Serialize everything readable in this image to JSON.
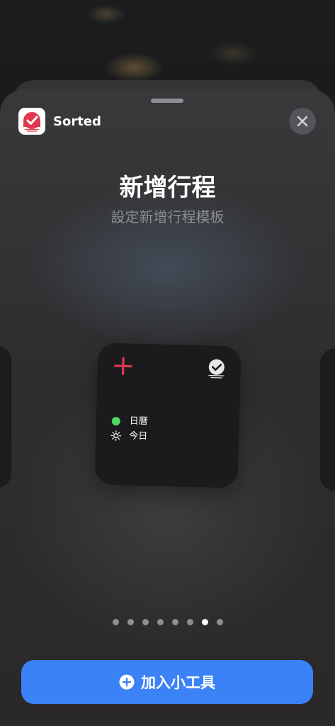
{
  "app": {
    "name": "Sorted"
  },
  "header": {
    "title": "新增行程",
    "subtitle": "設定新增行程模板"
  },
  "widget": {
    "rows": [
      {
        "label": "日曆",
        "icon": "green-dot-icon"
      },
      {
        "label": "今日",
        "icon": "sun-icon"
      }
    ]
  },
  "pager": {
    "count": 8,
    "active_index": 6
  },
  "actions": {
    "add_widget_label": "加入小工具"
  },
  "colors": {
    "accent_blue": "#3b82f6",
    "brand_red": "#e0394f",
    "calendar_green": "#4cd964"
  }
}
